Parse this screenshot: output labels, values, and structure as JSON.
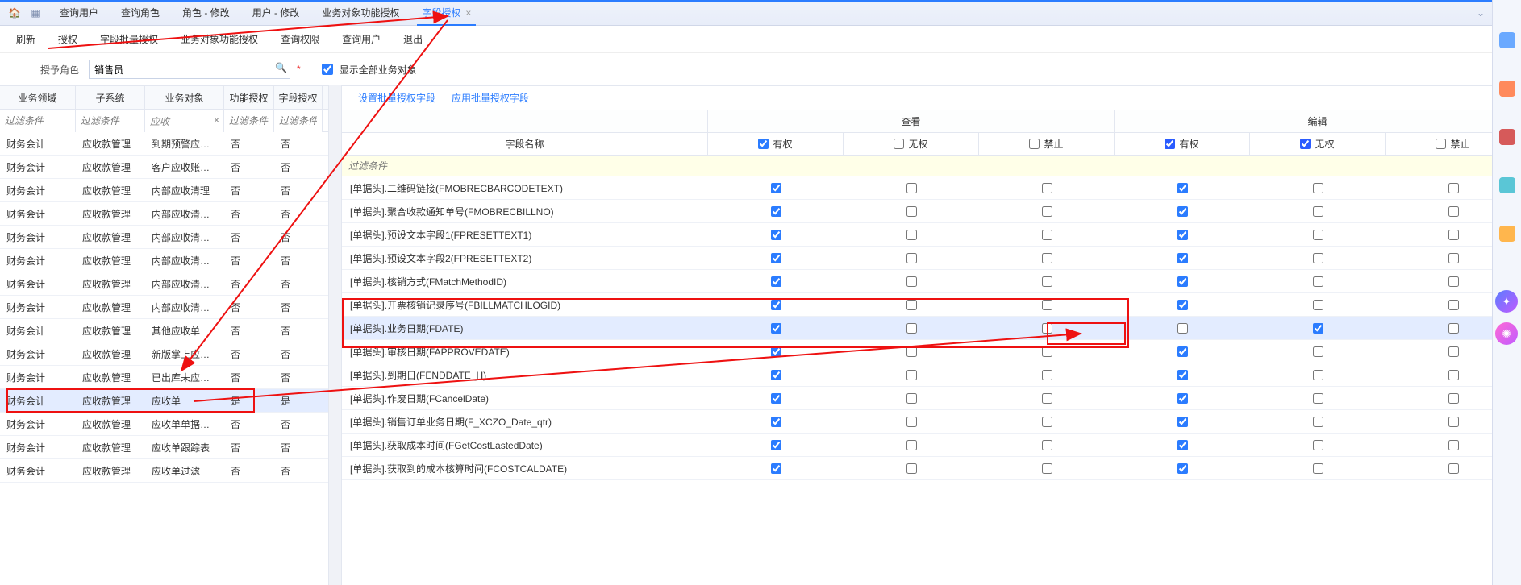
{
  "tabs": {
    "t0": "查询用户",
    "t1": "查询角色",
    "t2": "角色 - 修改",
    "t3": "用户 - 修改",
    "t4": "业务对象功能授权",
    "t5": "字段授权"
  },
  "toolbar": {
    "b0": "刷新",
    "b1": "授权",
    "b2": "字段批量授权",
    "b3": "业务对象功能授权",
    "b4": "查询权限",
    "b5": "查询用户",
    "b6": "退出"
  },
  "role": {
    "label": "授予角色",
    "value": "销售员",
    "show_all": "显示全部业务对象"
  },
  "left": {
    "headers": {
      "c1": "业务领域",
      "c2": "子系统",
      "c3": "业务对象",
      "c4": "功能授权",
      "c5": "字段授权"
    },
    "filter_placeholder": "过滤条件",
    "filter_c3_value": "应收",
    "rows": [
      {
        "c1": "财务会计",
        "c2": "应收款管理",
        "c3": "到期预警应收数据…",
        "c4": "否",
        "c5": "否"
      },
      {
        "c1": "财务会计",
        "c2": "应收款管理",
        "c3": "客户应收账款排…",
        "c4": "否",
        "c5": "否"
      },
      {
        "c1": "财务会计",
        "c2": "应收款管理",
        "c3": "内部应收清理",
        "c4": "否",
        "c5": "否"
      },
      {
        "c1": "财务会计",
        "c2": "应收款管理",
        "c3": "内部应收清理(ht…",
        "c4": "否",
        "c5": "否"
      },
      {
        "c1": "财务会计",
        "c2": "应收款管理",
        "c3": "内部应收清理单",
        "c4": "否",
        "c5": "否"
      },
      {
        "c1": "财务会计",
        "c2": "应收款管理",
        "c3": "内部应收清理记录",
        "c4": "否",
        "c5": "否"
      },
      {
        "c1": "财务会计",
        "c2": "应收款管理",
        "c3": "内部应收清理-无…",
        "c4": "否",
        "c5": "否"
      },
      {
        "c1": "财务会计",
        "c2": "应收款管理",
        "c3": "内部应收清理-无…",
        "c4": "否",
        "c5": "否"
      },
      {
        "c1": "财务会计",
        "c2": "应收款管理",
        "c3": "其他应收单",
        "c4": "否",
        "c5": "否"
      },
      {
        "c1": "财务会计",
        "c2": "应收款管理",
        "c3": "新版掌上应收_单…",
        "c4": "否",
        "c5": "否"
      },
      {
        "c1": "财务会计",
        "c2": "应收款管理",
        "c3": "已出库未应收明…",
        "c4": "否",
        "c5": "否"
      },
      {
        "c1": "财务会计",
        "c2": "应收款管理",
        "c3": "应收单",
        "c4": "是",
        "c5": "是",
        "sel": true
      },
      {
        "c1": "财务会计",
        "c2": "应收款管理",
        "c3": "应收单单据类型…",
        "c4": "否",
        "c5": "否"
      },
      {
        "c1": "财务会计",
        "c2": "应收款管理",
        "c3": "应收单跟踪表",
        "c4": "否",
        "c5": "否"
      },
      {
        "c1": "财务会计",
        "c2": "应收款管理",
        "c3": "应收单过滤",
        "c4": "否",
        "c5": "否"
      }
    ]
  },
  "right": {
    "link1": "设置批量授权字段",
    "link2": "应用批量授权字段",
    "col_name": "字段名称",
    "grp_view": "查看",
    "grp_edit": "编辑",
    "sub": {
      "yq": "有权",
      "wq": "无权",
      "jz": "禁止"
    },
    "filter_placeholder": "过滤条件",
    "rows": [
      {
        "name": "[单据头].二维码链接(FMOBRECBARCODETEXT)",
        "v": [
          true,
          false,
          false
        ],
        "e": [
          true,
          false,
          false
        ]
      },
      {
        "name": "[单据头].聚合收款通知单号(FMOBRECBILLNO)",
        "v": [
          true,
          false,
          false
        ],
        "e": [
          true,
          false,
          false
        ]
      },
      {
        "name": "[单据头].预设文本字段1(FPRESETTEXT1)",
        "v": [
          true,
          false,
          false
        ],
        "e": [
          true,
          false,
          false
        ]
      },
      {
        "name": "[单据头].预设文本字段2(FPRESETTEXT2)",
        "v": [
          true,
          false,
          false
        ],
        "e": [
          true,
          false,
          false
        ]
      },
      {
        "name": "[单据头].核销方式(FMatchMethodID)",
        "v": [
          true,
          false,
          false
        ],
        "e": [
          true,
          false,
          false
        ]
      },
      {
        "name": "[单据头].开票核销记录序号(FBILLMATCHLOGID)",
        "v": [
          true,
          false,
          false
        ],
        "e": [
          true,
          false,
          false
        ]
      },
      {
        "name": "[单据头].业务日期(FDATE)",
        "v": [
          true,
          false,
          false
        ],
        "e": [
          false,
          true,
          false
        ],
        "sel": true
      },
      {
        "name": "[单据头].审核日期(FAPPROVEDATE)",
        "v": [
          true,
          false,
          false
        ],
        "e": [
          true,
          false,
          false
        ]
      },
      {
        "name": "[单据头].到期日(FENDDATE_H)",
        "v": [
          true,
          false,
          false
        ],
        "e": [
          true,
          false,
          false
        ]
      },
      {
        "name": "[单据头].作废日期(FCancelDate)",
        "v": [
          true,
          false,
          false
        ],
        "e": [
          true,
          false,
          false
        ]
      },
      {
        "name": "[单据头].销售订单业务日期(F_XCZO_Date_qtr)",
        "v": [
          true,
          false,
          false
        ],
        "e": [
          true,
          false,
          false
        ]
      },
      {
        "name": "[单据头].获取成本时间(FGetCostLastedDate)",
        "v": [
          true,
          false,
          false
        ],
        "e": [
          true,
          false,
          false
        ]
      },
      {
        "name": "[单据头].获取到的成本核算时间(FCOSTCALDATE)",
        "v": [
          true,
          false,
          false
        ],
        "e": [
          true,
          false,
          false
        ]
      }
    ]
  }
}
